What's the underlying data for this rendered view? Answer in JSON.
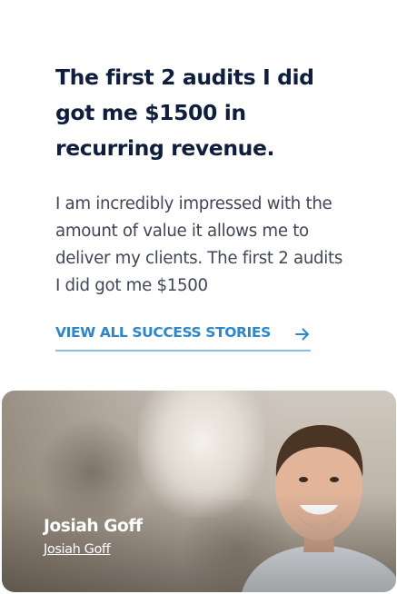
{
  "testimonial": {
    "headline": "The first 2 audits I did got me $1500 in recurring revenue.",
    "quote": "I am incredibly impressed with the amount of value it allows me to deliver my clients. The first 2 audits I did got me $1500",
    "cta_label": "VIEW ALL SUCCESS STORIES",
    "cta_icon": "arrow-right-icon"
  },
  "author": {
    "name": "Josiah Goff",
    "link_label": "Josiah Goff"
  },
  "colors": {
    "headline": "#0f1e3d",
    "body_text": "#3f4656",
    "accent": "#2f86c9",
    "accent_underline": "#8cc0e6"
  }
}
